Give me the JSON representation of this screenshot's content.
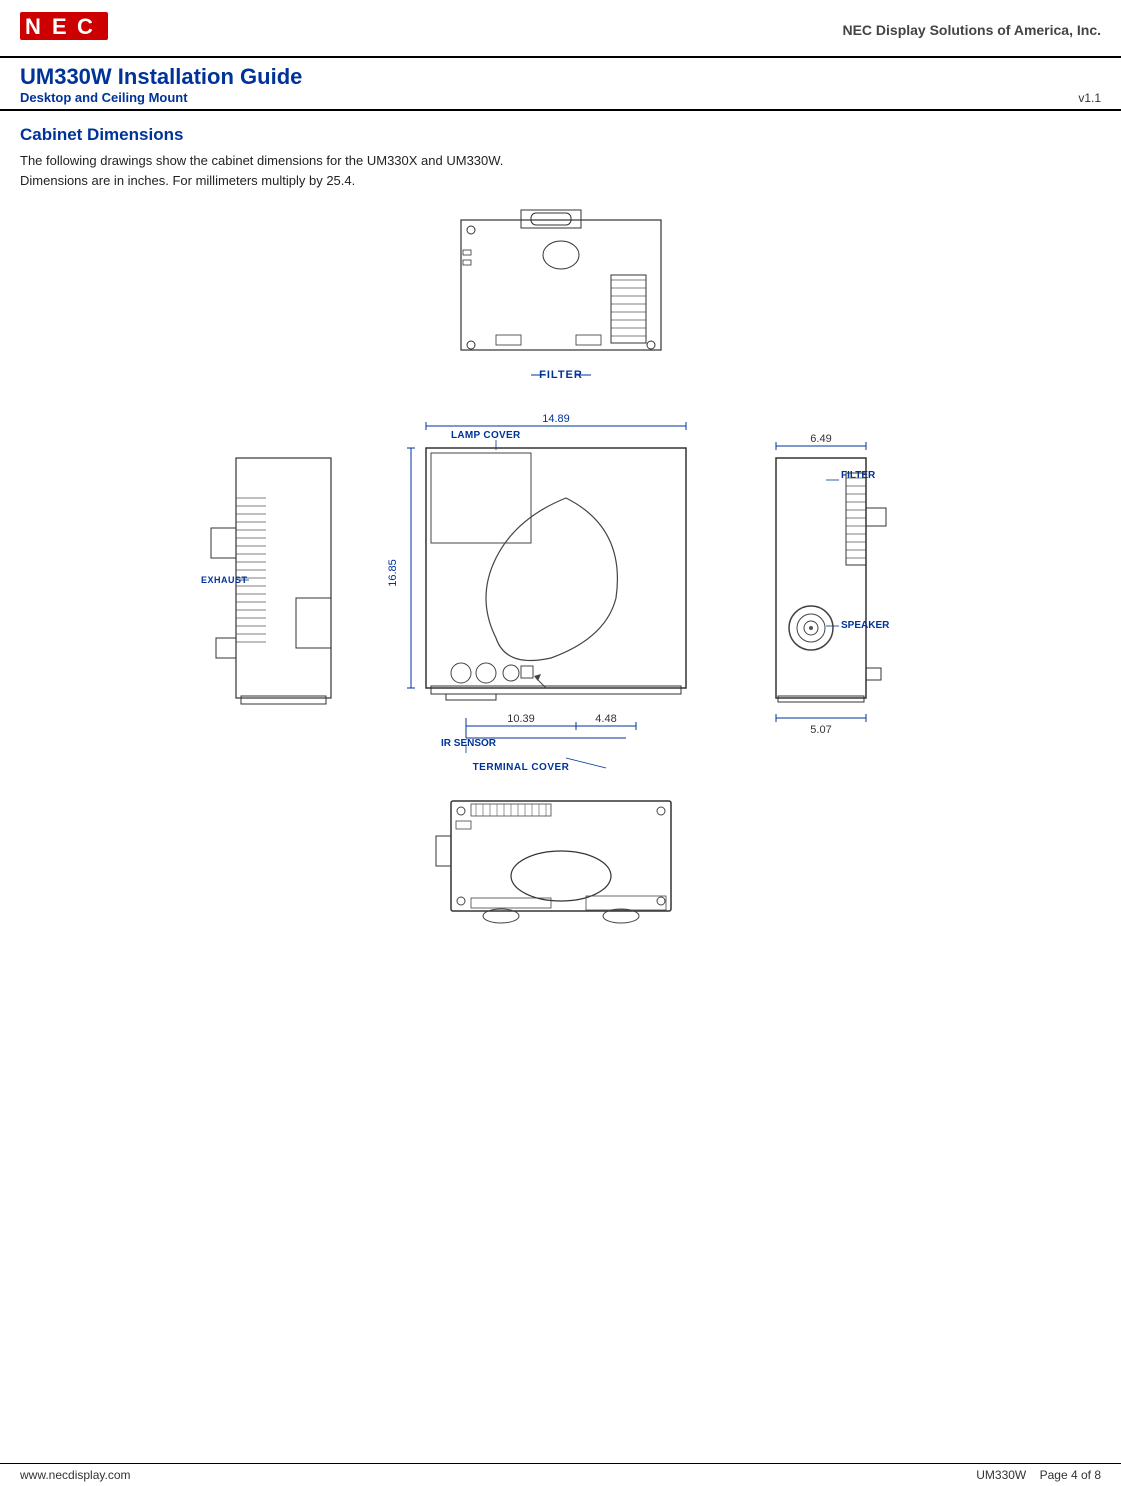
{
  "header": {
    "company": "NEC Display Solutions of America, Inc.",
    "logo_text": "NEC"
  },
  "title": {
    "main": "UM330W Installation Guide",
    "subtitle": "Desktop and Ceiling Mount",
    "version": "v1.1"
  },
  "section": {
    "heading": "Cabinet Dimensions",
    "description_line1": "The following drawings show the cabinet dimensions for the UM330X and UM330W.",
    "description_line2": "Dimensions are in inches. For millimeters multiply by 25.4."
  },
  "dimensions": {
    "width": "14.89",
    "height": "16.85",
    "right_width": "6.49",
    "bottom_right": "5.07",
    "lower_left": "10.39",
    "lower_right": "4.48"
  },
  "labels": {
    "filter_top": "FILTER",
    "lamp_cover": "LAMP COVER",
    "exhaust": "EXHAUST",
    "filter_right": "FILTER",
    "speaker": "SPEAKER",
    "ir_sensor": "IR SENSOR",
    "terminal_cover": "TERMINAL COVER"
  },
  "footer": {
    "website": "www.necdisplay.com",
    "model": "UM330W",
    "page_info": "Page 4 of 8"
  }
}
